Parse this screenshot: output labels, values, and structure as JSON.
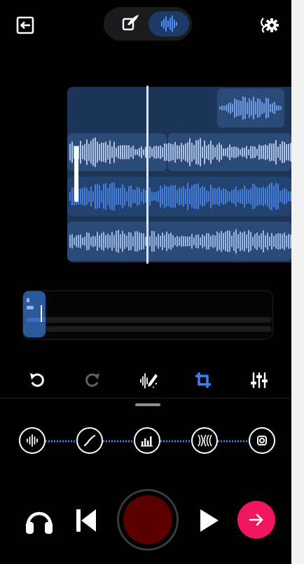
{
  "colors": {
    "background": "#000000",
    "clip_fill": "#1d3658",
    "wave_light": "#7fb0ff",
    "wave_bright": "#4d8df5",
    "accent_blue": "#3b82f6",
    "record": "#5a0000",
    "next": "#f0175f"
  },
  "topbar": {
    "exit_icon": "exit-icon",
    "settings_icon": "audio-settings-icon",
    "modes": [
      {
        "icon": "compose-icon",
        "active": false
      },
      {
        "icon": "waveform-icon",
        "active": true
      }
    ]
  },
  "editor": {
    "clip_count": 5,
    "tracks": 4
  },
  "tools": [
    {
      "icon": "undo-icon",
      "enabled": true
    },
    {
      "icon": "redo-icon",
      "enabled": false
    },
    {
      "icon": "magic-edit-icon",
      "enabled": true
    },
    {
      "icon": "crop-icon",
      "active": true
    },
    {
      "icon": "mixer-sliders-icon",
      "enabled": true
    }
  ],
  "fx_chain": [
    {
      "icon": "waveform-fx-icon"
    },
    {
      "icon": "curve-fx-icon"
    },
    {
      "icon": "equalizer-fx-icon"
    },
    {
      "icon": "echo-fx-icon"
    },
    {
      "icon": "output-fx-icon"
    }
  ],
  "transport": {
    "monitor_icon": "headphones-icon",
    "rewind_icon": "skip-back-icon",
    "record_icon": "record-button",
    "play_icon": "play-icon",
    "next_icon": "arrow-right-icon"
  }
}
